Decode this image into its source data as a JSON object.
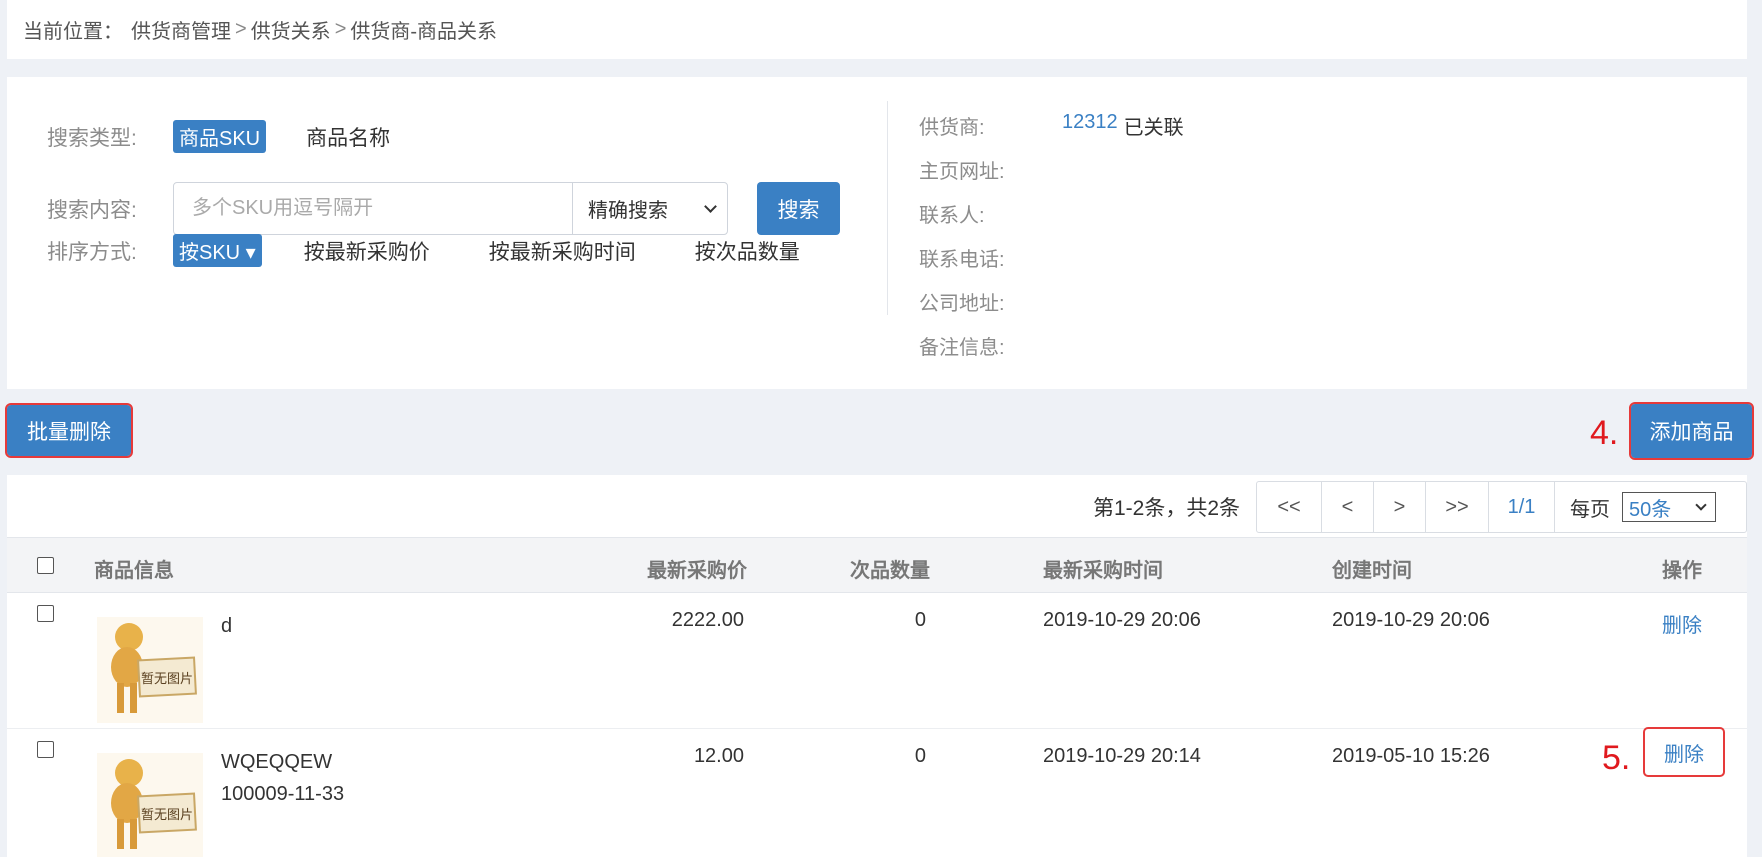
{
  "breadcrumb": {
    "prefix": "当前位置：",
    "items": [
      "供货商管理",
      "供货关系",
      "供货商-商品关系"
    ],
    "separator": ">"
  },
  "search": {
    "type_label": "搜索类型:",
    "type_options": [
      "商品SKU",
      "商品名称"
    ],
    "content_label": "搜索内容:",
    "placeholder": "多个SKU用逗号隔开",
    "mode_selected": "精确搜索",
    "search_button": "搜索",
    "sort_label": "排序方式:",
    "sort_options": [
      "按SKU ▾",
      "按最新采购价",
      "按最新采购时间",
      "按次品数量"
    ]
  },
  "supplier": {
    "rows": [
      {
        "label": "供货商:",
        "value": "12312",
        "extra": "已关联"
      },
      {
        "label": "主页网址:",
        "value": ""
      },
      {
        "label": "联系人:",
        "value": ""
      },
      {
        "label": "联系电话:",
        "value": ""
      },
      {
        "label": "公司地址:",
        "value": ""
      },
      {
        "label": "备注信息:",
        "value": ""
      }
    ]
  },
  "actions": {
    "bulk_delete": "批量删除",
    "add_product": "添加商品",
    "step4": "4.",
    "step5": "5."
  },
  "pager": {
    "summary": "第1-2条，共2条",
    "first": "<<",
    "prev": "<",
    "next": ">",
    "last": ">>",
    "page": "1/1",
    "per_page_label": "每页",
    "per_page_value": "50条"
  },
  "table": {
    "headers": {
      "info": "商品信息",
      "price": "最新采购价",
      "defect": "次品数量",
      "purchase_time": "最新采购时间",
      "created": "创建时间",
      "action": "操作"
    },
    "placeholder_image_text": "暂无图片",
    "rows": [
      {
        "name": "d",
        "sku": "",
        "price": "2222.00",
        "defect": "0",
        "purchase_time": "2019-10-29 20:06",
        "created": "2019-10-29 20:06",
        "action": "删除"
      },
      {
        "name": "WQEQQEW",
        "sku": "100009-11-33",
        "price": "12.00",
        "defect": "0",
        "purchase_time": "2019-10-29 20:14",
        "created": "2019-05-10 15:26",
        "action": "删除"
      }
    ]
  },
  "colors": {
    "primary": "#3a80c4",
    "highlight_red": "#e63a3a"
  }
}
